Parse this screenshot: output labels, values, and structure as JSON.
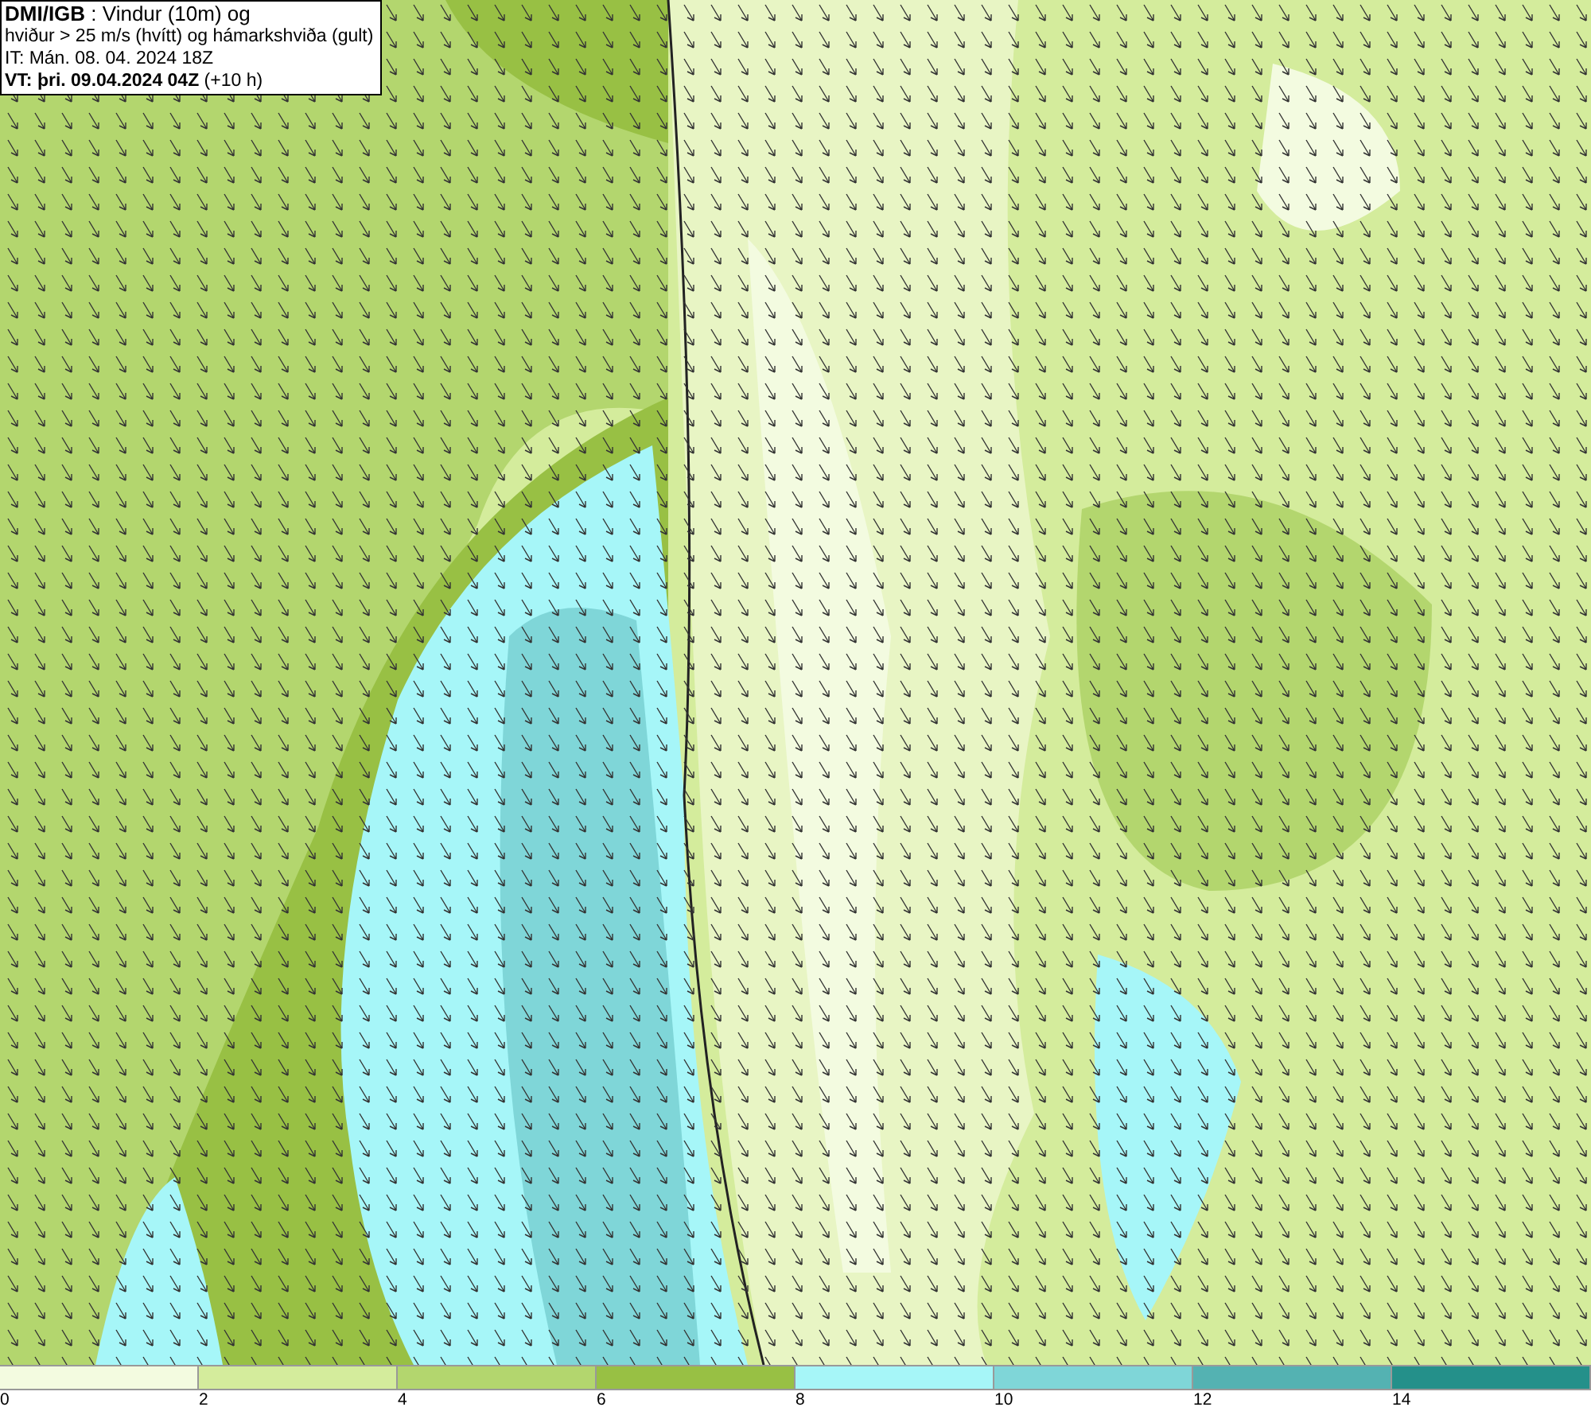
{
  "header": {
    "lines": [
      "**DMI/IGB** : Vindur (10m) og",
      "hviður > 25 m/s (hvítt) og hámarkshviða (gult)",
      "IT: Mán. 08. 04. 2024 18Z",
      "**VT: þri. 09.04.2024 04Z** (+10 h)"
    ]
  },
  "legend": {
    "bins": [
      {
        "color": "#f3fbe0",
        "label": "0"
      },
      {
        "color": "#d4ec9c",
        "label": "2"
      },
      {
        "color": "#b3d66e",
        "label": "4"
      },
      {
        "color": "#98c044",
        "label": "6"
      },
      {
        "color": "#a6f6f8",
        "label": "8"
      },
      {
        "color": "#7fd6d8",
        "label": "10"
      },
      {
        "color": "#54b2b2",
        "label": "12"
      },
      {
        "color": "#24908a",
        "label": "14"
      }
    ]
  }
}
